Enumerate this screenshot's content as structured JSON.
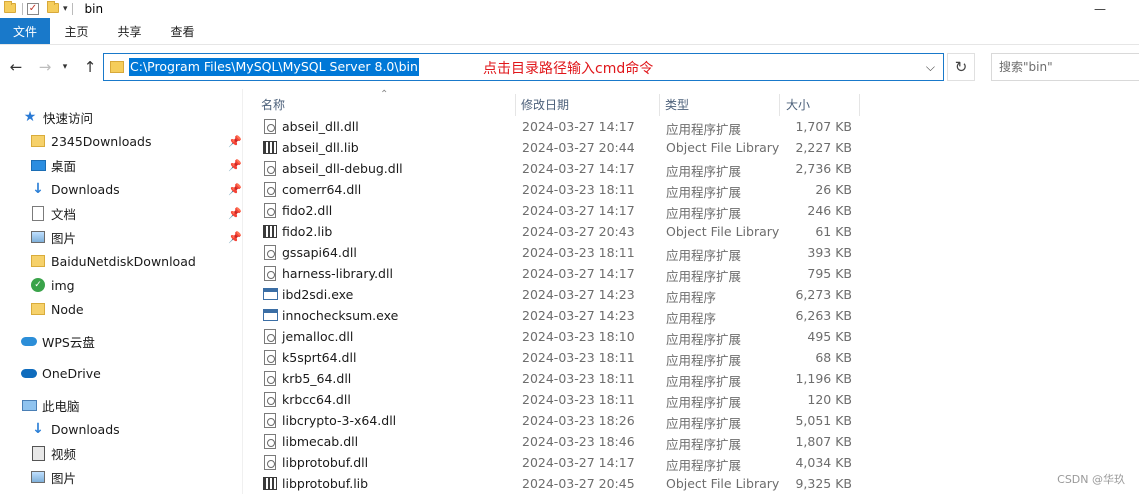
{
  "window": {
    "title": "bin",
    "minimize": "—"
  },
  "ribbon": {
    "tabs": [
      "文件",
      "主页",
      "共享",
      "查看"
    ]
  },
  "address": {
    "path": "C:\\Program Files\\MySQL\\MySQL Server 8.0\\bin",
    "annotation": "点击目录路径输入cmd命令"
  },
  "search": {
    "placeholder": "搜索\"bin\""
  },
  "sidebar": {
    "quick_access": "快速访问",
    "items": [
      {
        "label": "2345Downloads",
        "icon": "folder-icon",
        "pinned": true
      },
      {
        "label": "桌面",
        "icon": "desktop-icon",
        "pinned": true
      },
      {
        "label": "Downloads",
        "icon": "download-arrow-icon",
        "pinned": true
      },
      {
        "label": "文档",
        "icon": "document-icon",
        "pinned": true
      },
      {
        "label": "图片",
        "icon": "picture-icon",
        "pinned": true
      },
      {
        "label": "BaiduNetdiskDownload",
        "icon": "folder-icon",
        "pinned": false
      },
      {
        "label": "img",
        "icon": "img-folder-icon",
        "pinned": false
      },
      {
        "label": "Node",
        "icon": "folder-icon",
        "pinned": false
      }
    ],
    "wps": "WPS云盘",
    "onedrive": "OneDrive",
    "this_pc": "此电脑",
    "pc_items": [
      {
        "label": "Downloads",
        "icon": "download-arrow-icon"
      },
      {
        "label": "视频",
        "icon": "video-icon"
      },
      {
        "label": "图片",
        "icon": "picture-icon"
      }
    ]
  },
  "columns": {
    "name": "名称",
    "date": "修改日期",
    "type": "类型",
    "size": "大小"
  },
  "files": [
    {
      "name": "abseil_dll.dll",
      "date": "2024-03-27 14:17",
      "type": "应用程序扩展",
      "size": "1,707 KB",
      "kind": "dll"
    },
    {
      "name": "abseil_dll.lib",
      "date": "2024-03-27 20:44",
      "type": "Object File Library",
      "size": "2,227 KB",
      "kind": "lib"
    },
    {
      "name": "abseil_dll-debug.dll",
      "date": "2024-03-27 14:17",
      "type": "应用程序扩展",
      "size": "2,736 KB",
      "kind": "dll"
    },
    {
      "name": "comerr64.dll",
      "date": "2024-03-23 18:11",
      "type": "应用程序扩展",
      "size": "26 KB",
      "kind": "dll"
    },
    {
      "name": "fido2.dll",
      "date": "2024-03-27 14:17",
      "type": "应用程序扩展",
      "size": "246 KB",
      "kind": "dll"
    },
    {
      "name": "fido2.lib",
      "date": "2024-03-27 20:43",
      "type": "Object File Library",
      "size": "61 KB",
      "kind": "lib"
    },
    {
      "name": "gssapi64.dll",
      "date": "2024-03-23 18:11",
      "type": "应用程序扩展",
      "size": "393 KB",
      "kind": "dll"
    },
    {
      "name": "harness-library.dll",
      "date": "2024-03-27 14:17",
      "type": "应用程序扩展",
      "size": "795 KB",
      "kind": "dll"
    },
    {
      "name": "ibd2sdi.exe",
      "date": "2024-03-27 14:23",
      "type": "应用程序",
      "size": "6,273 KB",
      "kind": "exe"
    },
    {
      "name": "innochecksum.exe",
      "date": "2024-03-27 14:23",
      "type": "应用程序",
      "size": "6,263 KB",
      "kind": "exe"
    },
    {
      "name": "jemalloc.dll",
      "date": "2024-03-23 18:10",
      "type": "应用程序扩展",
      "size": "495 KB",
      "kind": "dll"
    },
    {
      "name": "k5sprt64.dll",
      "date": "2024-03-23 18:11",
      "type": "应用程序扩展",
      "size": "68 KB",
      "kind": "dll"
    },
    {
      "name": "krb5_64.dll",
      "date": "2024-03-23 18:11",
      "type": "应用程序扩展",
      "size": "1,196 KB",
      "kind": "dll"
    },
    {
      "name": "krbcc64.dll",
      "date": "2024-03-23 18:11",
      "type": "应用程序扩展",
      "size": "120 KB",
      "kind": "dll"
    },
    {
      "name": "libcrypto-3-x64.dll",
      "date": "2024-03-23 18:26",
      "type": "应用程序扩展",
      "size": "5,051 KB",
      "kind": "dll"
    },
    {
      "name": "libmecab.dll",
      "date": "2024-03-23 18:46",
      "type": "应用程序扩展",
      "size": "1,807 KB",
      "kind": "dll"
    },
    {
      "name": "libprotobuf.dll",
      "date": "2024-03-27 14:17",
      "type": "应用程序扩展",
      "size": "4,034 KB",
      "kind": "dll"
    },
    {
      "name": "libprotobuf.lib",
      "date": "2024-03-27 20:45",
      "type": "Object File Library",
      "size": "9,325 KB",
      "kind": "lib"
    }
  ],
  "watermark": "CSDN @华玖"
}
